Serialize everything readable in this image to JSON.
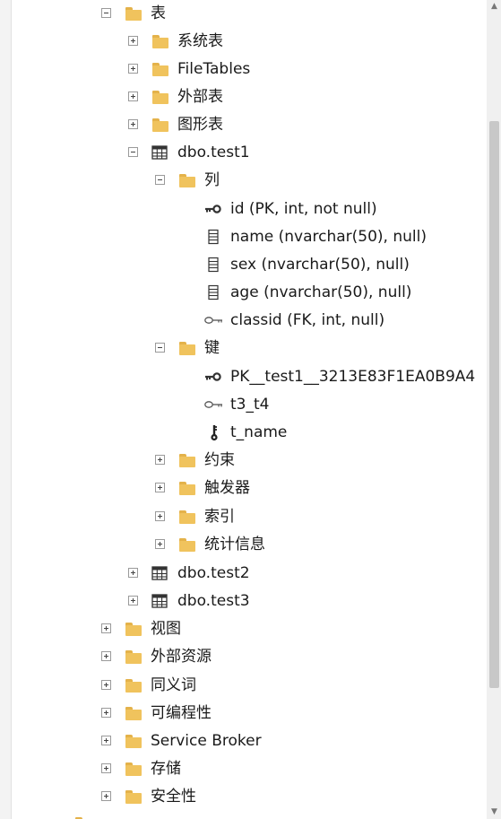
{
  "tree": {
    "tables_folder": "表",
    "system_tables": "系统表",
    "filetables": "FileTables",
    "external_tables": "外部表",
    "graph_tables": "图形表",
    "test1": {
      "name": "dbo.test1",
      "columns_folder": "列",
      "columns": [
        {
          "label": "id (PK, int, not null)",
          "icon": "primary-key-icon"
        },
        {
          "label": "name (nvarchar(50), null)",
          "icon": "column-icon"
        },
        {
          "label": "sex (nvarchar(50), null)",
          "icon": "column-icon"
        },
        {
          "label": "age (nvarchar(50), null)",
          "icon": "column-icon"
        },
        {
          "label": "classid (FK, int, null)",
          "icon": "foreign-key-icon"
        }
      ],
      "keys_folder": "键",
      "keys": [
        {
          "label": "PK__test1__3213E83F1EA0B9A4",
          "icon": "primary-key-icon"
        },
        {
          "label": "t3_t4",
          "icon": "foreign-key-icon"
        },
        {
          "label": "t_name",
          "icon": "unique-key-icon"
        }
      ],
      "constraints_folder": "约束",
      "triggers_folder": "触发器",
      "indexes_folder": "索引",
      "statistics_folder": "统计信息"
    },
    "test2": "dbo.test2",
    "test3": "dbo.test3",
    "views": "视图",
    "external_resources": "外部资源",
    "synonyms": "同义词",
    "programmability": "可编程性",
    "service_broker": "Service Broker",
    "storage": "存储",
    "security": "安全性"
  },
  "colors": {
    "folder": "#f0c35d",
    "folder_tab": "#e4b24a",
    "scroll_thumb": "#c8c8c8"
  }
}
